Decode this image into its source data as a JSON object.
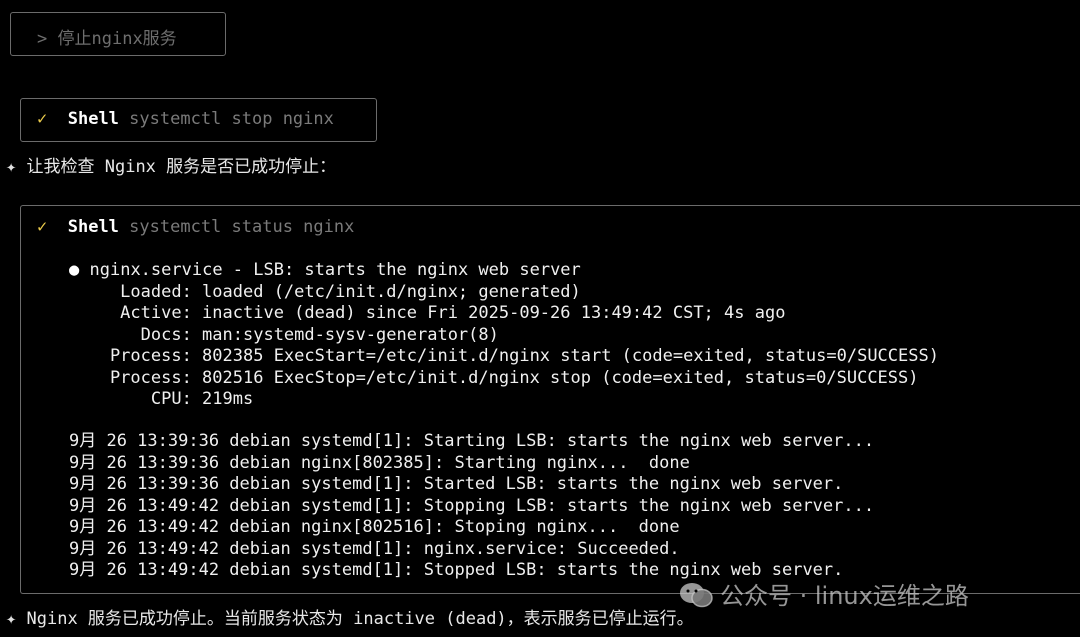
{
  "user_prompt": {
    "arrow": ">",
    "text": "停止nginx服务"
  },
  "tool_calls": [
    {
      "check": "✓",
      "tool": "Shell",
      "command": "systemctl stop nginx"
    },
    {
      "check": "✓",
      "tool": "Shell",
      "command": "systemctl status nginx"
    }
  ],
  "assistant_messages": [
    {
      "star": "✦",
      "text": "让我检查 Nginx 服务是否已成功停止："
    },
    {
      "star": "✦",
      "text": "Nginx 服务已成功停止。当前服务状态为 inactive (dead)，表示服务已停止运行。"
    }
  ],
  "status_output": {
    "bullet": "●",
    "lines": [
      "nginx.service - LSB: starts the nginx web server",
      "     Loaded: loaded (/etc/init.d/nginx; generated)",
      "     Active: inactive (dead) since Fri 2025-09-26 13:49:42 CST; 4s ago",
      "       Docs: man:systemd-sysv-generator(8)",
      "    Process: 802385 ExecStart=/etc/init.d/nginx start (code=exited, status=0/SUCCESS)",
      "    Process: 802516 ExecStop=/etc/init.d/nginx stop (code=exited, status=0/SUCCESS)",
      "        CPU: 219ms"
    ]
  },
  "log_lines": [
    "9月 26 13:39:36 debian systemd[1]: Starting LSB: starts the nginx web server...",
    "9月 26 13:39:36 debian nginx[802385]: Starting nginx...  done",
    "9月 26 13:39:36 debian systemd[1]: Started LSB: starts the nginx web server.",
    "9月 26 13:49:42 debian systemd[1]: Stopping LSB: starts the nginx web server...",
    "9月 26 13:49:42 debian nginx[802516]: Stoping nginx...  done",
    "9月 26 13:49:42 debian systemd[1]: nginx.service: Succeeded.",
    "9月 26 13:49:42 debian systemd[1]: Stopped LSB: starts the nginx web server."
  ],
  "watermark": {
    "icon": "wechat-icon",
    "text": "公众号 · linux运维之路"
  },
  "colors": {
    "background": "#000000",
    "border": "#6b6b6b",
    "check": "#e8c84a",
    "command": "#7a7a7a",
    "prompt": "#6e6e6e"
  }
}
